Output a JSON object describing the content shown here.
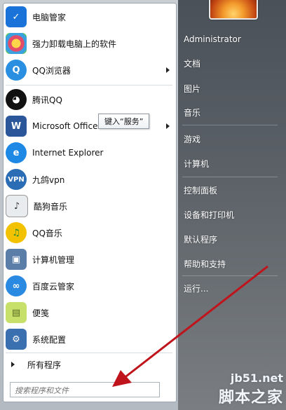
{
  "left_menu": {
    "items": [
      {
        "label": "电脑管家",
        "icon": "shield-check-icon",
        "color": "#1a73d9"
      },
      {
        "label": "强力卸载电脑上的软件",
        "icon": "flower-petals-icon",
        "color": "#e44d6a"
      },
      {
        "label": "QQ浏览器",
        "icon": "qq-browser-icon",
        "color": "#2a8fe0"
      },
      {
        "label": "腾讯QQ",
        "icon": "penguin-icon",
        "color": "#222222"
      },
      {
        "label": "Microsoft Office",
        "icon": "word-document-icon",
        "color": "#2b579a"
      },
      {
        "label": "Internet Explorer",
        "icon": "internet-explorer-icon",
        "color": "#1e88e5"
      },
      {
        "label": "九鸽vpn",
        "icon": "vpn-icon",
        "color": "#2a6db5"
      },
      {
        "label": "酷狗音乐",
        "icon": "music-note-icon",
        "color": "#444444"
      },
      {
        "label": "QQ音乐",
        "icon": "qq-music-icon",
        "color": "#e5b800"
      },
      {
        "label": "计算机管理",
        "icon": "computer-management-icon",
        "color": "#5b7ea8"
      },
      {
        "label": "百度云管家",
        "icon": "cloud-icon",
        "color": "#2a89e0"
      },
      {
        "label": "便笺",
        "icon": "sticky-note-icon",
        "color": "#c7e06a"
      },
      {
        "label": "系统配置",
        "icon": "system-config-icon",
        "color": "#3a6fb0"
      }
    ],
    "all_programs": "所有程序",
    "search_placeholder": "搜索程序和文件"
  },
  "tooltip": {
    "text": "键入“服务”"
  },
  "right_menu": {
    "items": [
      "Administrator",
      "文档",
      "图片",
      "音乐",
      "游戏",
      "计算机",
      "控制面板",
      "设备和打印机",
      "默认程序",
      "帮助和支持",
      "运行..."
    ]
  },
  "watermark": {
    "line1": "jb51.net",
    "line2": "脚本之家"
  },
  "colors": {
    "annotation_arrow": "#c0141c",
    "right_panel": "#4a5158"
  }
}
